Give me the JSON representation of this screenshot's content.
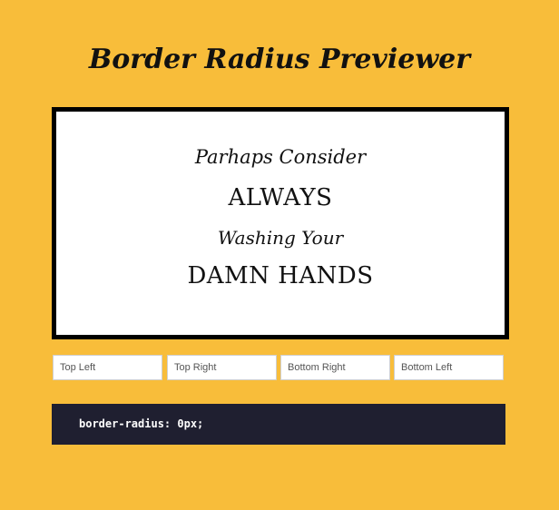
{
  "page": {
    "title": "Border Radius Previewer"
  },
  "preview": {
    "lines": [
      "Parhaps Consider",
      "ALWAYS",
      "Washing Your",
      "DAMN HANDS"
    ],
    "background": "#ffffff",
    "border_color": "#000000"
  },
  "inputs": {
    "top_left_placeholder": "Top Left",
    "top_right_placeholder": "Top Right",
    "bottom_right_placeholder": "Bottom Right",
    "bottom_left_placeholder": "Bottom Left",
    "top_left_value": "",
    "top_right_value": "",
    "bottom_right_value": "",
    "bottom_left_value": ""
  },
  "output": {
    "css_text": "border-radius: 0px;"
  },
  "colors": {
    "page_background": "#f8bd3a",
    "code_background": "#1f1f30",
    "code_text": "#ffffff"
  }
}
